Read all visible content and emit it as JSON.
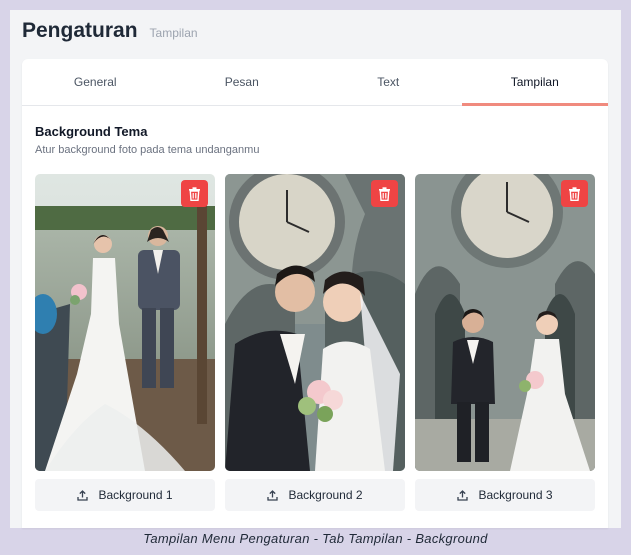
{
  "header": {
    "title": "Pengaturan",
    "subtitle": "Tampilan"
  },
  "tabs": [
    {
      "label": "General",
      "active": false
    },
    {
      "label": "Pesan",
      "active": false
    },
    {
      "label": "Text",
      "active": false
    },
    {
      "label": "Tampilan",
      "active": true
    }
  ],
  "section": {
    "title": "Background Tema",
    "description": "Atur background foto pada tema undanganmu"
  },
  "backgrounds": [
    {
      "label": "Background 1",
      "icon": "upload-icon",
      "delete_icon": "trash-icon"
    },
    {
      "label": "Background 2",
      "icon": "upload-icon",
      "delete_icon": "trash-icon"
    },
    {
      "label": "Background 3",
      "icon": "upload-icon",
      "delete_icon": "trash-icon"
    }
  ],
  "caption": "Tampilan Menu Pengaturan - Tab Tampilan - Background",
  "colors": {
    "accent": "#f08a7e",
    "danger": "#ef4444"
  }
}
